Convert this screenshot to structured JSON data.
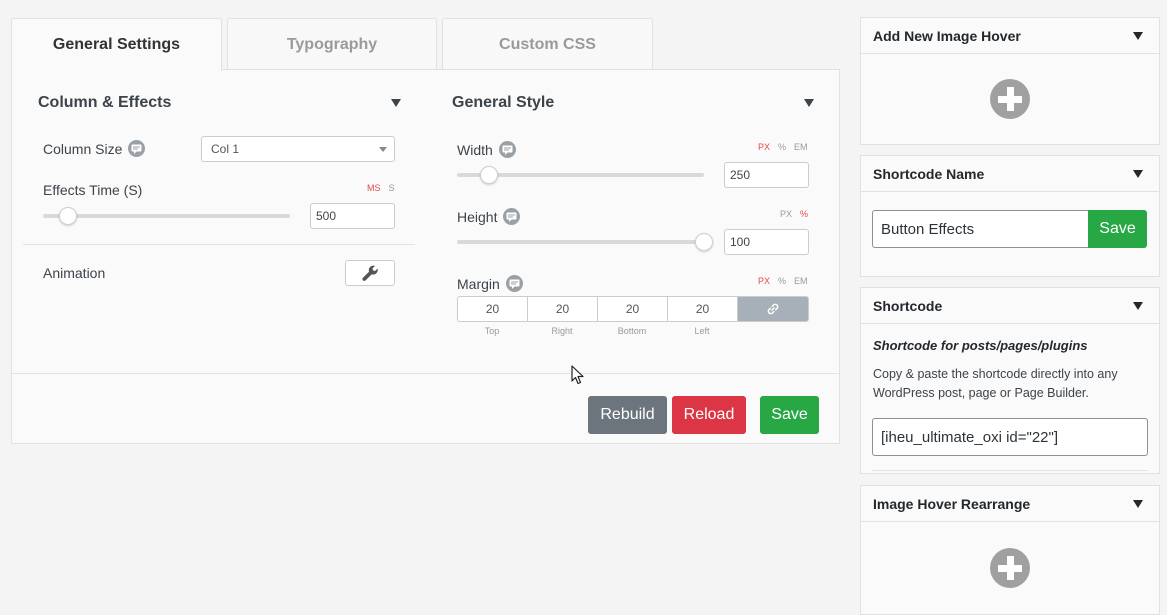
{
  "tabs": [
    {
      "label": "General Settings",
      "active": true
    },
    {
      "label": "Typography",
      "active": false
    },
    {
      "label": "Custom CSS",
      "active": false
    }
  ],
  "column_effects": {
    "title": "Column & Effects",
    "column_size_label": "Column Size",
    "column_size_value": "Col 1",
    "effects_time_label": "Effects Time (S)",
    "effects_time_units": [
      "MS",
      "S"
    ],
    "effects_time_active_unit": "MS",
    "effects_time_value": "500",
    "animation_label": "Animation"
  },
  "general_style": {
    "title": "General Style",
    "width_label": "Width",
    "width_units": [
      "PX",
      "%",
      "EM"
    ],
    "width_active_unit": "PX",
    "width_value": "250",
    "height_label": "Height",
    "height_units": [
      "PX",
      "%"
    ],
    "height_active_unit": "%",
    "height_value": "100",
    "margin_label": "Margin",
    "margin_units": [
      "PX",
      "%",
      "EM"
    ],
    "margin_active_unit": "PX",
    "margin_values": [
      "20",
      "20",
      "20",
      "20"
    ],
    "margin_sides": [
      "Top",
      "Right",
      "Bottom",
      "Left"
    ]
  },
  "actions": {
    "rebuild": "Rebuild",
    "reload": "Reload",
    "save": "Save"
  },
  "sidebar": {
    "add_new": {
      "title": "Add New Image Hover"
    },
    "shortcode_name": {
      "title": "Shortcode Name",
      "value": "Button Effects",
      "save": "Save"
    },
    "shortcode": {
      "title": "Shortcode",
      "subtitle": "Shortcode for posts/pages/plugins",
      "description": "Copy & paste the shortcode directly into any WordPress post, page or Page Builder.",
      "value": "[iheu_ultimate_oxi id=\"22\"]"
    },
    "rearrange": {
      "title": "Image Hover Rearrange"
    }
  },
  "colors": {
    "rebuild": "#6c757d",
    "reload": "#dc3545",
    "save": "#28a745",
    "active_unit": "#e24b4b"
  }
}
